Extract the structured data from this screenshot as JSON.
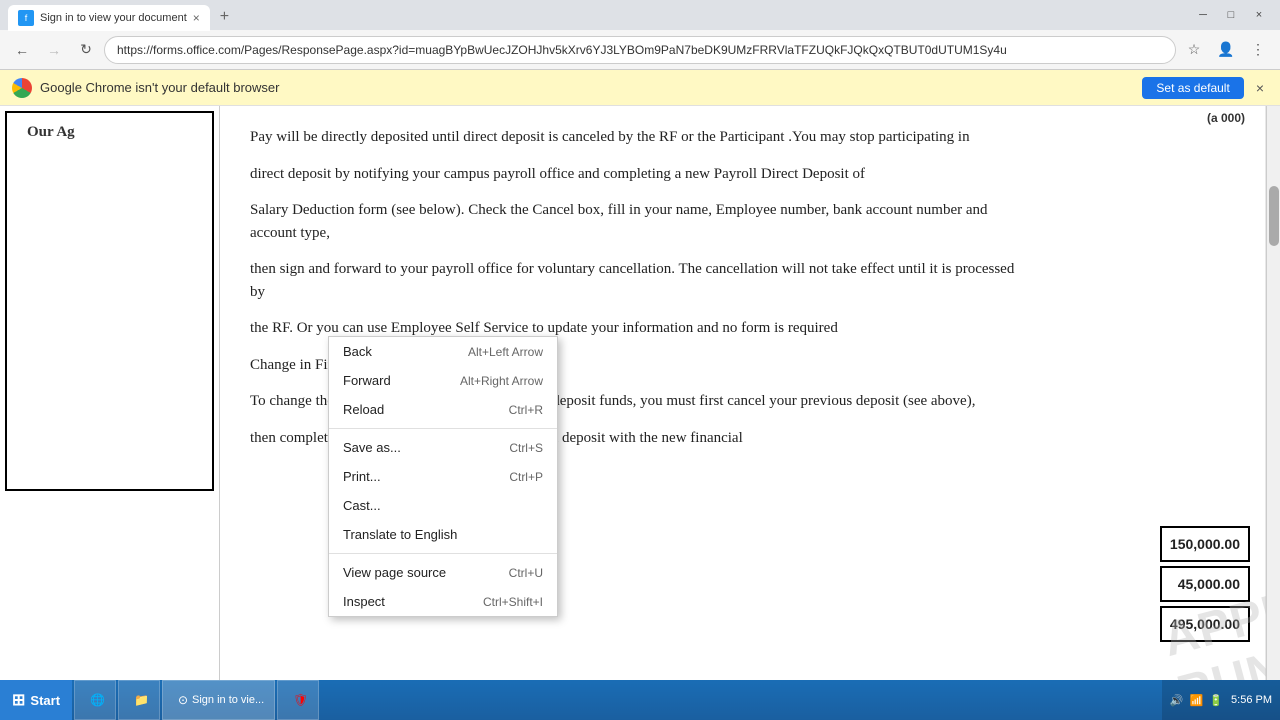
{
  "browser": {
    "tab": {
      "favicon_text": "f",
      "title": "Sign in to view your document",
      "close": "×"
    },
    "new_tab": "+",
    "window_controls": {
      "minimize": "─",
      "maximize": "□",
      "close": "×"
    },
    "nav": {
      "back": "←",
      "forward": "→",
      "reload": "↻",
      "url": "https://forms.office.com/Pages/ResponsePage.aspx?id=muagBYpBwUecJZOHJhv5kXrv6YJ3LYBOm9PaN7beDK9UMzFRRVlaTFZUQkFJQkQxQTBUT0dUTUM1Sy4u",
      "star": "☆",
      "profile": "○",
      "menu": "⋮"
    },
    "notification": {
      "text": "Google Chrome isn't your default browser",
      "button": "Set as default",
      "close": "×"
    }
  },
  "document": {
    "left_panel_title": "Our Ag",
    "paragraphs": [
      "Pay will be directly deposited until direct deposit is canceled by the RF or the Participant .You may stop participating in",
      "direct deposit by notifying your campus payroll office and completing a new Payroll Direct Deposit of",
      "Salary Deduction form (see below). Check the Cancel box, fill in your name, Employee number, bank account number and account type,",
      "then sign and forward to your payroll office for voluntary cancellation.  The cancellation will not take effect until it is processed by",
      "the RF. Or you can use Employee Self Service to update your information and no form is required",
      "Change in Financial Institution:",
      "To change the financial institution into which you deposit funds, you must first cancel your previous deposit (see above),",
      "then complete a new enrollment form to start direct deposit with the new financial"
    ],
    "right_numbers": [
      "(a 000)",
      "150,000.00",
      "45,000.00",
      "495,000.00"
    ],
    "watermark": "APPROVAL RUN"
  },
  "context_menu": {
    "items": [
      {
        "label": "Back",
        "shortcut": "Alt+Left Arrow",
        "disabled": false
      },
      {
        "label": "Forward",
        "shortcut": "Alt+Right Arrow",
        "disabled": false
      },
      {
        "label": "Reload",
        "shortcut": "Ctrl+R",
        "disabled": false
      },
      {
        "separator": true
      },
      {
        "label": "Save as...",
        "shortcut": "Ctrl+S",
        "disabled": false
      },
      {
        "label": "Print...",
        "shortcut": "Ctrl+P",
        "disabled": false
      },
      {
        "label": "Cast...",
        "shortcut": "",
        "disabled": false
      },
      {
        "label": "Translate to English",
        "shortcut": "",
        "disabled": false
      },
      {
        "separator": true
      },
      {
        "label": "View page source",
        "shortcut": "Ctrl+U",
        "disabled": false
      },
      {
        "label": "Inspect",
        "shortcut": "Ctrl+Shift+I",
        "disabled": false
      }
    ]
  },
  "taskbar": {
    "start": "Start",
    "time": "5:56 PM",
    "items": [
      {
        "label": "IE",
        "icon": "🌐"
      },
      {
        "label": "Folder",
        "icon": "📁"
      },
      {
        "label": "Chrome",
        "icon": "⊙"
      },
      {
        "label": "Shield",
        "icon": "🛡"
      }
    ]
  }
}
